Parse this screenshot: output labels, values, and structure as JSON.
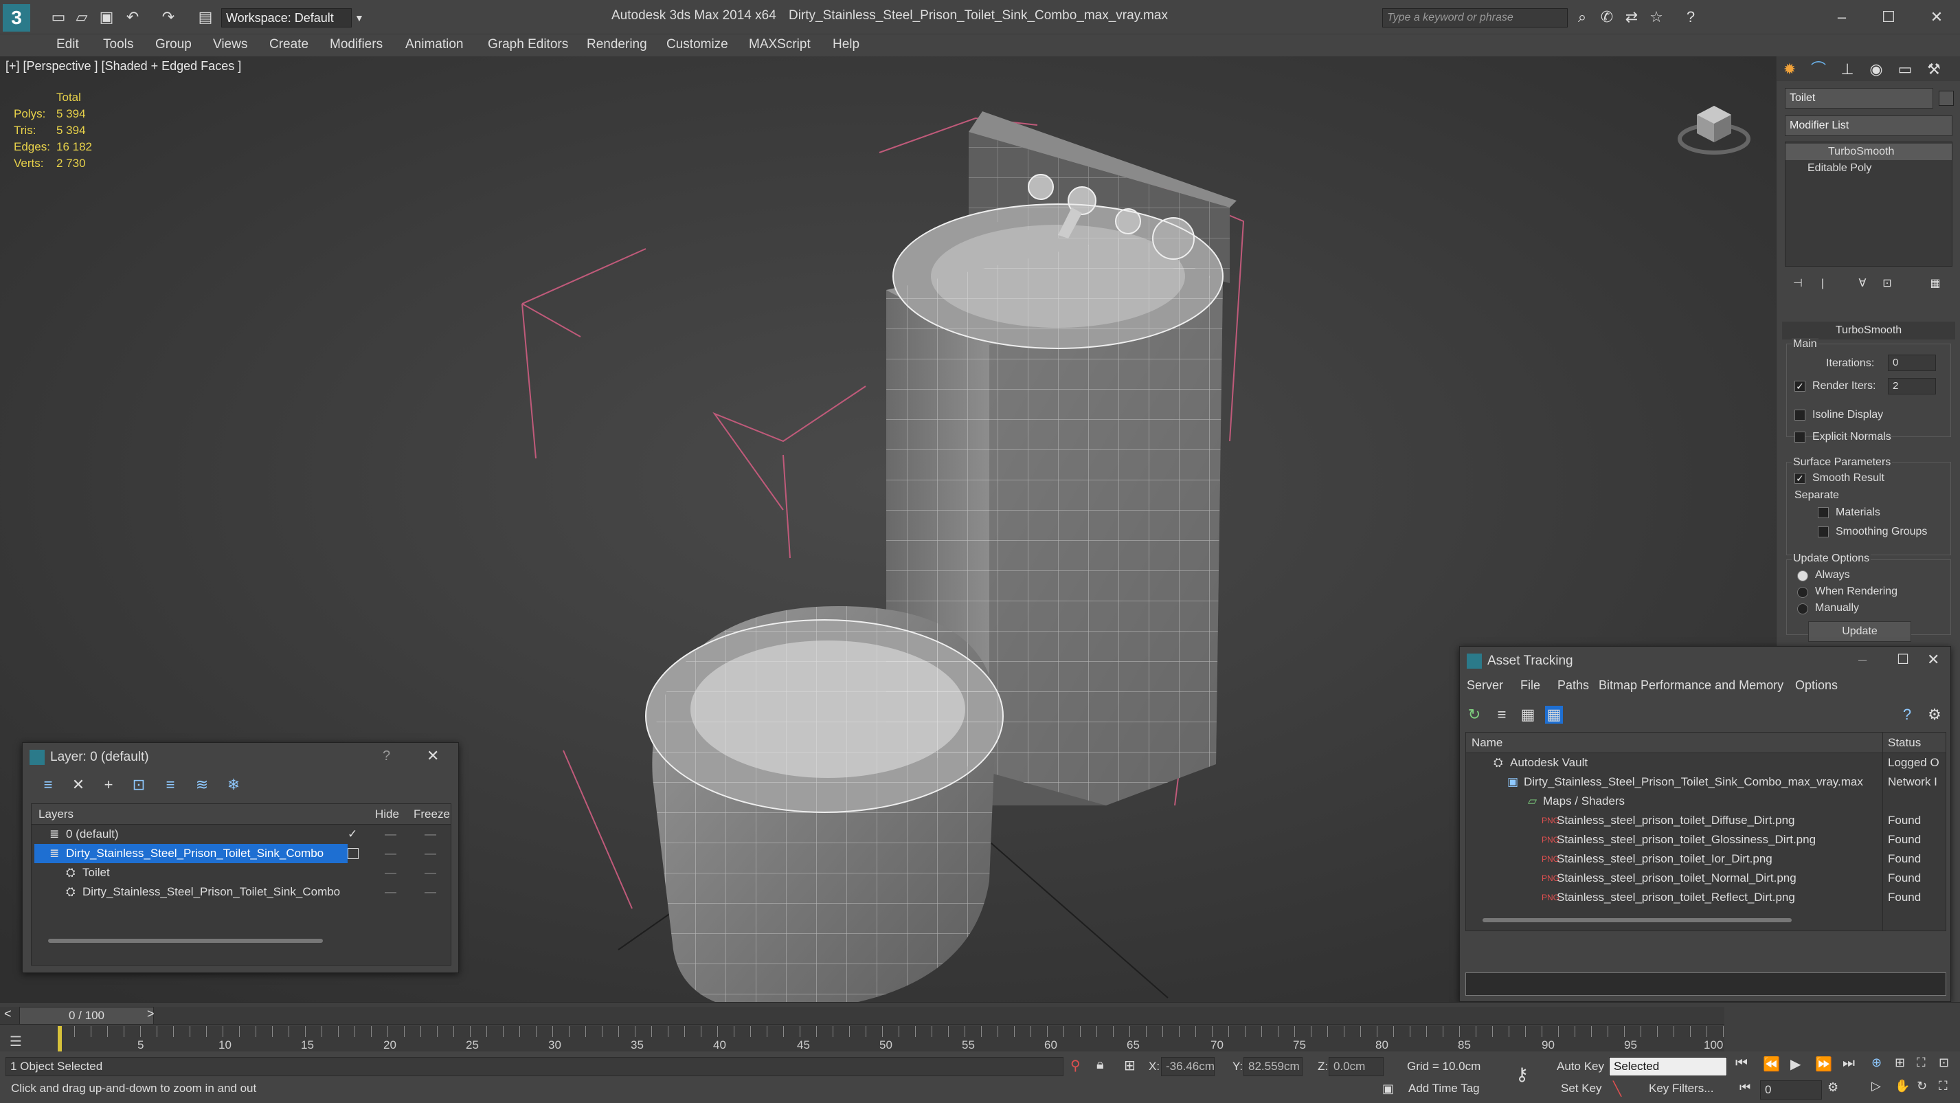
{
  "titlebar": {
    "app_title": "Autodesk 3ds Max  2014 x64",
    "file_title": "Dirty_Stainless_Steel_Prison_Toilet_Sink_Combo_max_vray.max",
    "workspace": "Workspace: Default",
    "search_placeholder": "Type a keyword or phrase"
  },
  "menu": [
    "Edit",
    "Tools",
    "Group",
    "Views",
    "Create",
    "Modifiers",
    "Animation",
    "Graph Editors",
    "Rendering",
    "Customize",
    "MAXScript",
    "Help"
  ],
  "viewport": {
    "label": "[+] [Perspective ] [Shaded + Edged Faces ]",
    "stats": {
      "header": "Total",
      "rows": [
        {
          "label": "Polys:",
          "value": "5 394"
        },
        {
          "label": "Tris:",
          "value": "5 394"
        },
        {
          "label": "Edges:",
          "value": "16 182"
        },
        {
          "label": "Verts:",
          "value": "2 730"
        }
      ]
    }
  },
  "command_panel": {
    "object_name": "Toilet",
    "modifier_list": "Modifier List",
    "stack": [
      "TurboSmooth",
      "Editable Poly"
    ],
    "rollout_title": "TurboSmooth",
    "main_group": "Main",
    "iterations_label": "Iterations:",
    "iterations_value": "0",
    "render_iters_label": "Render Iters:",
    "render_iters_value": "2",
    "isoline_label": "Isoline Display",
    "explicit_normals_label": "Explicit Normals",
    "surface_group": "Surface Parameters",
    "smooth_result_label": "Smooth Result",
    "separate_label": "Separate",
    "materials_label": "Materials",
    "smoothing_groups_label": "Smoothing Groups",
    "update_group": "Update Options",
    "always_label": "Always",
    "when_rendering_label": "When Rendering",
    "manually_label": "Manually",
    "update_button": "Update"
  },
  "layer_dialog": {
    "title": "Layer: 0 (default)",
    "help": "?",
    "col_layers": "Layers",
    "col_hide": "Hide",
    "col_freeze": "Freeze",
    "rows": [
      {
        "name": "0 (default)"
      },
      {
        "name": "Dirty_Stainless_Steel_Prison_Toilet_Sink_Combo"
      },
      {
        "name": "Toilet"
      },
      {
        "name": "Dirty_Stainless_Steel_Prison_Toilet_Sink_Combo"
      }
    ]
  },
  "asset_dialog": {
    "title": "Asset Tracking",
    "menu": [
      "Server",
      "File",
      "Paths",
      "Bitmap Performance and Memory",
      "Options"
    ],
    "col_name": "Name",
    "col_status": "Status",
    "rows": [
      {
        "name": "Autodesk Vault",
        "status": "Logged O"
      },
      {
        "name": "Dirty_Stainless_Steel_Prison_Toilet_Sink_Combo_max_vray.max",
        "status": "Network I"
      },
      {
        "name": "Maps / Shaders",
        "status": ""
      },
      {
        "name": "Stainless_steel_prison_toilet_Diffuse_Dirt.png",
        "status": "Found"
      },
      {
        "name": "Stainless_steel_prison_toilet_Glossiness_Dirt.png",
        "status": "Found"
      },
      {
        "name": "Stainless_steel_prison_toilet_Ior_Dirt.png",
        "status": "Found"
      },
      {
        "name": "Stainless_steel_prison_toilet_Normal_Dirt.png",
        "status": "Found"
      },
      {
        "name": "Stainless_steel_prison_toilet_Reflect_Dirt.png",
        "status": "Found"
      }
    ]
  },
  "timeline": {
    "frame": "0 / 100",
    "ticks": [
      "5",
      "10",
      "15",
      "20",
      "25",
      "30",
      "35",
      "40",
      "45",
      "50",
      "55",
      "60",
      "65",
      "70",
      "75",
      "80",
      "85",
      "90",
      "95",
      "100"
    ]
  },
  "status": {
    "selected": "1 Object Selected",
    "hint": "Click and drag up-and-down to zoom in and out",
    "x_label": "X:",
    "x_value": "-36.46cm",
    "y_label": "Y:",
    "y_value": "82.559cm",
    "z_label": "Z:",
    "z_value": "0.0cm",
    "grid": "Grid = 10.0cm",
    "add_time_tag": "Add Time Tag",
    "auto_key": "Auto Key",
    "selected_dropdown": "Selected",
    "set_key": "Set Key",
    "key_filters": "Key Filters...",
    "frame_value": "0"
  }
}
